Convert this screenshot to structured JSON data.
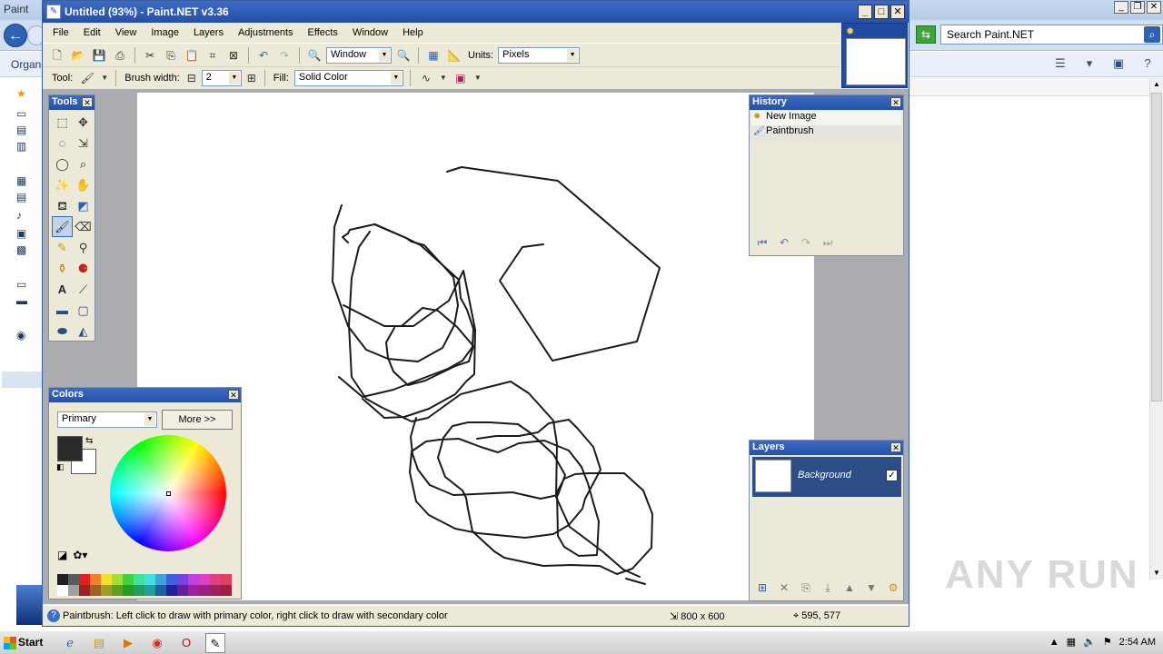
{
  "background_window": {
    "title": "Paint",
    "search_placeholder": "Search Paint.NET",
    "organize_label": "Organi"
  },
  "watermark": "ANY RUN",
  "app": {
    "title": "Untitled (93%) - Paint.NET v3.36",
    "menu": [
      "File",
      "Edit",
      "View",
      "Image",
      "Layers",
      "Adjustments",
      "Effects",
      "Window",
      "Help"
    ],
    "zoom_value": "Window",
    "units_label": "Units:",
    "units_value": "Pixels",
    "tool_label": "Tool:",
    "brush_width_label": "Brush width:",
    "brush_width_value": "2",
    "fill_label": "Fill:",
    "fill_value": "Solid Color"
  },
  "panels": {
    "tools_title": "Tools",
    "history_title": "History",
    "history_items": [
      "New Image",
      "Paintbrush"
    ],
    "layers_title": "Layers",
    "layer_name": "Background",
    "colors_title": "Colors",
    "color_mode": "Primary",
    "more_label": "More >>"
  },
  "status": {
    "hint": "Paintbrush: Left click to draw with primary color, right click to draw with secondary color",
    "image_size": "800 x 600",
    "cursor_pos": "595, 577"
  },
  "taskbar": {
    "start_label": "Start",
    "clock": "2:54 AM"
  },
  "colors": {
    "primary": "#2b2b2b",
    "secondary": "#ffffff",
    "title_bar": "#2452a6",
    "palette": [
      "#202020",
      "#5a5a5a",
      "#e02020",
      "#f08030",
      "#f0e030",
      "#a0e030",
      "#40d040",
      "#40e0a0",
      "#40e0e0",
      "#40a0e0",
      "#4060e0",
      "#8040e0",
      "#c040e0",
      "#e040c0",
      "#e04080",
      "#e04060",
      "#ffffff",
      "#a0a0a0",
      "#a02020",
      "#a06020",
      "#a0a020",
      "#60a020",
      "#20a020",
      "#20a060",
      "#20a0a0",
      "#2060a0",
      "#2020a0",
      "#6020a0",
      "#a020a0",
      "#a02080",
      "#a02060",
      "#a02040"
    ]
  }
}
